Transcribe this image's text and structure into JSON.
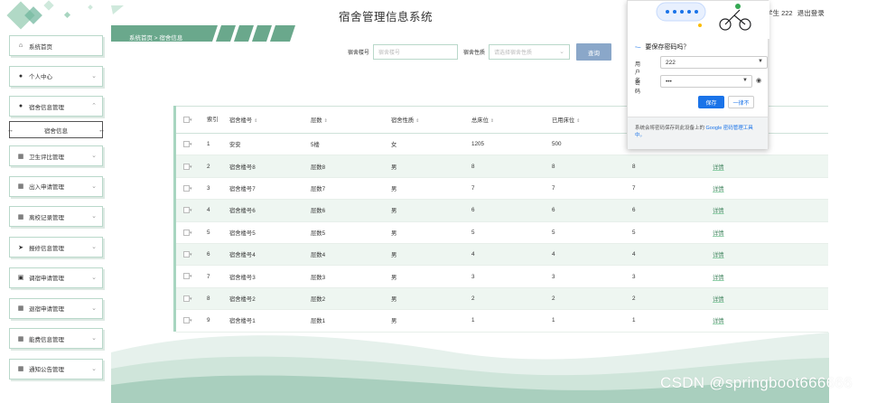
{
  "app": {
    "title": "宿舍管理信息系统"
  },
  "header": {
    "user_label": "学生 222",
    "logout_label": "退出登录"
  },
  "breadcrumb": {
    "text": "系统首页 > 宿舍信息"
  },
  "sidebar": {
    "items": [
      {
        "label": "系统首页",
        "icon": "home-icon"
      },
      {
        "label": "个人中心",
        "icon": "user-icon"
      },
      {
        "label": "宿舍信息管理",
        "icon": "user-icon",
        "expanded": true,
        "submenu": "宿舍信息"
      },
      {
        "label": "卫生评比管理",
        "icon": "grid-icon"
      },
      {
        "label": "出入申请管理",
        "icon": "grid-icon"
      },
      {
        "label": "离校记录管理",
        "icon": "grid-icon"
      },
      {
        "label": "报修信息管理",
        "icon": "send-icon"
      },
      {
        "label": "调宿申请管理",
        "icon": "clipboard-icon"
      },
      {
        "label": "退宿申请管理",
        "icon": "grid-icon"
      },
      {
        "label": "能费信息管理",
        "icon": "grid-icon"
      },
      {
        "label": "通知公告管理",
        "icon": "grid-icon"
      }
    ]
  },
  "search": {
    "building_label": "宿舍楼号",
    "building_placeholder": "宿舍楼号",
    "type_label": "宿舍性质",
    "type_placeholder": "请选择宿舍性质",
    "query_label": "查询"
  },
  "table": {
    "columns": [
      "索引",
      "宿舍楼号",
      "层数",
      "宿舍性质",
      "总床位",
      "已用床位"
    ],
    "rows": [
      {
        "idx": "1",
        "building": "安安",
        "floors": "5楼",
        "type": "女",
        "total": "1205",
        "used": "500",
        "free": "",
        "action": ""
      },
      {
        "idx": "2",
        "building": "宿舍楼号8",
        "floors": "层数8",
        "type": "男",
        "total": "8",
        "used": "8",
        "free": "8",
        "action": "详情"
      },
      {
        "idx": "3",
        "building": "宿舍楼号7",
        "floors": "层数7",
        "type": "男",
        "total": "7",
        "used": "7",
        "free": "7",
        "action": "详情"
      },
      {
        "idx": "4",
        "building": "宿舍楼号6",
        "floors": "层数6",
        "type": "男",
        "total": "6",
        "used": "6",
        "free": "6",
        "action": "详情"
      },
      {
        "idx": "5",
        "building": "宿舍楼号5",
        "floors": "层数5",
        "type": "男",
        "total": "5",
        "used": "5",
        "free": "5",
        "action": "详情"
      },
      {
        "idx": "6",
        "building": "宿舍楼号4",
        "floors": "层数4",
        "type": "男",
        "total": "4",
        "used": "4",
        "free": "4",
        "action": "详情"
      },
      {
        "idx": "7",
        "building": "宿舍楼号3",
        "floors": "层数3",
        "type": "男",
        "total": "3",
        "used": "3",
        "free": "3",
        "action": "详情"
      },
      {
        "idx": "8",
        "building": "宿舍楼号2",
        "floors": "层数2",
        "type": "男",
        "total": "2",
        "used": "2",
        "free": "2",
        "action": "详情"
      },
      {
        "idx": "9",
        "building": "宿舍楼号1",
        "floors": "层数1",
        "type": "男",
        "total": "1",
        "used": "1",
        "free": "1",
        "action": "详情"
      }
    ]
  },
  "password_popup": {
    "title": "要保存密码吗？",
    "username_label": "用户名",
    "username_value": "222",
    "password_label": "密码",
    "password_value": "•••",
    "save_label": "保存",
    "never_label": "一律不",
    "footer_text": "系统会将密码保存到此设备上的 ",
    "footer_link": "Google 密码管理工具中。"
  },
  "watermark": "CSDN @springboot666666",
  "colors": {
    "accent_green": "#a8d5c0",
    "band_green": "#6aa88c",
    "query_button": "#8aa7c9",
    "google_blue": "#1a73e8"
  }
}
